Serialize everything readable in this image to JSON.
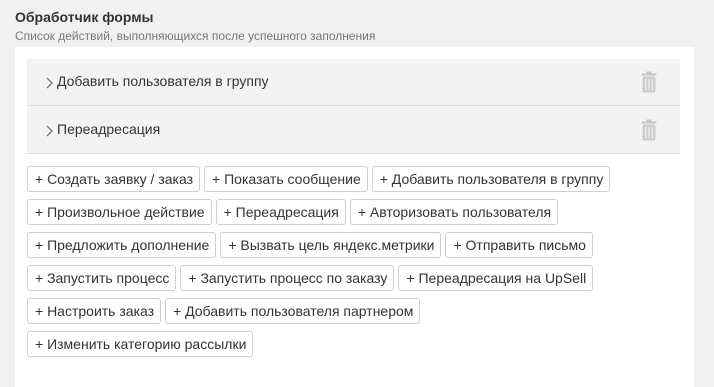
{
  "header": {
    "title": "Обработчик формы",
    "subtitle": "Список действий, выполняющихся после успешного заполнения"
  },
  "actions": [
    {
      "label": "Добавить пользователя в группу",
      "expand_icon": "chevron-right-icon",
      "delete_icon": "trash-icon"
    },
    {
      "label": "Переадресация",
      "expand_icon": "chevron-right-icon",
      "delete_icon": "trash-icon"
    }
  ],
  "add_buttons": [
    [
      "+ Создать заявку / заказ",
      "+ Показать сообщение",
      "+ Добавить пользователя в группу"
    ],
    [
      "+ Произвольное действие",
      "+ Переадресация",
      "+ Авторизовать пользователя"
    ],
    [
      "+ Предложить дополнение",
      "+ Вызвать цель яндекс.метрики",
      "+ Отправить письмо"
    ],
    [
      "+ Запустить процесс",
      "+ Запустить процесс по заказу",
      "+ Переадресация на UpSell"
    ],
    [
      "+ Настроить заказ",
      "+ Добавить пользователя партнером"
    ],
    [
      "+ Изменить категорию рассылки"
    ]
  ],
  "colors": {
    "page_bg": "#f1f1f1",
    "panel_bg": "#ffffff",
    "row_bg": "#f3f3f3",
    "border": "#cfcfcf",
    "icon": "#bbbbbb"
  }
}
